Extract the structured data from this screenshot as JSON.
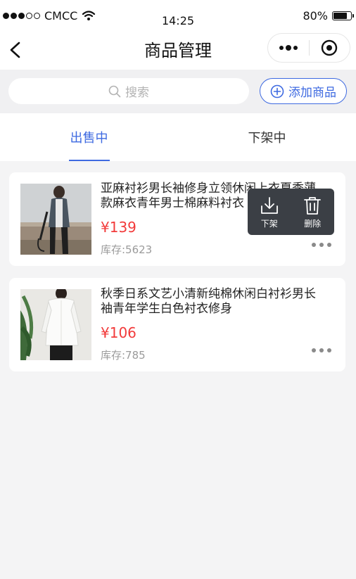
{
  "status_bar": {
    "carrier": "CMCC",
    "time": "14:25",
    "battery": "80%",
    "battery_level": 0.8
  },
  "nav": {
    "title": "商品管理"
  },
  "search": {
    "placeholder": "搜索"
  },
  "add_button": {
    "label": "添加商品"
  },
  "tabs": [
    {
      "label": "出售中",
      "active": true
    },
    {
      "label": "下架中",
      "active": false
    }
  ],
  "products": [
    {
      "title": "亚麻衬衫男长袖修身立领休闲上衣夏季薄款麻衣青年男士棉麻料衬衣",
      "price": "¥139",
      "stock": "库存:5623"
    },
    {
      "title": "秋季日系文艺小清新纯棉休闲白衬衫男长袖青年学生白色衬衣修身",
      "price": "¥106",
      "stock": "库存:785"
    }
  ],
  "popup": {
    "items": [
      {
        "label": "下架",
        "icon": "download-icon"
      },
      {
        "label": "删除",
        "icon": "trash-icon"
      }
    ]
  },
  "colors": {
    "accent": "#3e6ae1",
    "price": "#f23a3a",
    "popup_bg": "#3b3f45"
  }
}
